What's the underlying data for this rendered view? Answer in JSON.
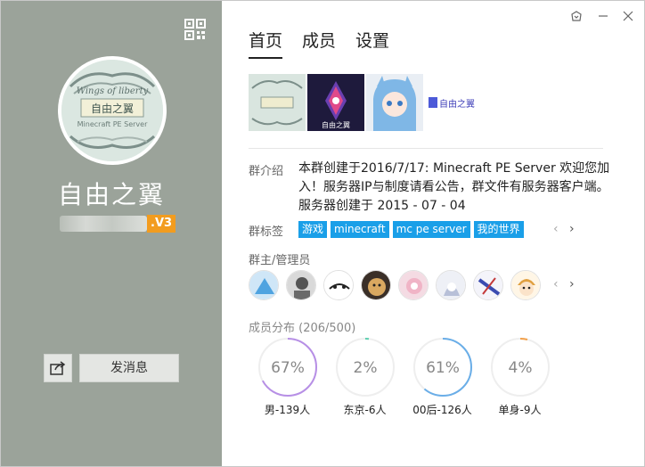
{
  "profile": {
    "group_name": "自由之翼",
    "level_badge": ".V3",
    "send_message_label": "发消息",
    "avatar_banner_text": "Wings of liberty",
    "avatar_cn_text": "自由之翼",
    "avatar_sub_text": "Minecraft PE Server"
  },
  "tabs": [
    {
      "label": "首页",
      "active": true
    },
    {
      "label": "成员",
      "active": false
    },
    {
      "label": "设置",
      "active": false
    }
  ],
  "photos": {
    "photo2_caption": "自由之翼",
    "logo_text": "自由之翼"
  },
  "info": {
    "intro_label": "群介绍",
    "intro_text": "本群创建于2016/7/17: Minecraft PE Server 欢迎您加入！服务器IP与制度请看公告，群文件有服务器客户端。服务器创建于 2015 - 07 - 04",
    "tags_label": "群标签",
    "tags": [
      "游戏",
      "minecraft",
      "mc pe server",
      "我的世界"
    ],
    "admins_label": "群主/管理员"
  },
  "distribution": {
    "title": "成员分布 (206/500)",
    "items": [
      {
        "percent": "67%",
        "fraction": 0.67,
        "label": "男-139人",
        "color": "#b78fe6"
      },
      {
        "percent": "2%",
        "fraction": 0.02,
        "label": "东京-6人",
        "color": "#5ccfb0"
      },
      {
        "percent": "61%",
        "fraction": 0.61,
        "label": "00后-126人",
        "color": "#6aaee8"
      },
      {
        "percent": "4%",
        "fraction": 0.04,
        "label": "单身-9人",
        "color": "#f2a04a"
      }
    ]
  },
  "colors": {
    "left_panel": "#9ba39a",
    "accent": "#1a9fe8",
    "level_badge": "#f29c1f"
  },
  "icons": [
    "qr-code-icon",
    "share-icon",
    "skin-icon",
    "minimize-icon",
    "close-icon",
    "arrow-left-icon",
    "arrow-right-icon"
  ]
}
